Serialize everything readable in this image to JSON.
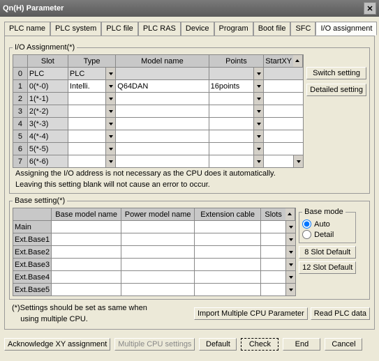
{
  "window": {
    "title": "Qn(H) Parameter",
    "close": "✕"
  },
  "tabs": [
    "PLC name",
    "PLC system",
    "PLC file",
    "PLC RAS",
    "Device",
    "Program",
    "Boot file",
    "SFC",
    "I/O assignment"
  ],
  "activeTab": "I/O assignment",
  "io": {
    "legend": "I/O Assignment(*)",
    "cols": {
      "slot": "Slot",
      "type": "Type",
      "model": "Model name",
      "points": "Points",
      "start": "StartXY"
    },
    "rows": [
      {
        "n": "0",
        "slot": "PLC",
        "type": "PLC",
        "model": "",
        "points": "",
        "gray": true
      },
      {
        "n": "1",
        "slot": "0(*-0)",
        "type": "Intelli.",
        "model": "Q64DAN",
        "points": "16points"
      },
      {
        "n": "2",
        "slot": "1(*-1)",
        "type": "",
        "model": "",
        "points": ""
      },
      {
        "n": "3",
        "slot": "2(*-2)",
        "type": "",
        "model": "",
        "points": ""
      },
      {
        "n": "4",
        "slot": "3(*-3)",
        "type": "",
        "model": "",
        "points": ""
      },
      {
        "n": "5",
        "slot": "4(*-4)",
        "type": "",
        "model": "",
        "points": ""
      },
      {
        "n": "6",
        "slot": "5(*-5)",
        "type": "",
        "model": "",
        "points": ""
      },
      {
        "n": "7",
        "slot": "6(*-6)",
        "type": "",
        "model": "",
        "points": ""
      }
    ],
    "switch": "Switch setting",
    "detailed": "Detailed setting",
    "note1": "Assigning the I/O address is not necessary as the CPU does it automatically.",
    "note2": "Leaving this setting blank will not cause an error to occur."
  },
  "base": {
    "legend": "Base setting(*)",
    "cols": {
      "base": "Base model name",
      "power": "Power model name",
      "ext": "Extension cable",
      "slots": "Slots"
    },
    "rows": [
      "Main",
      "Ext.Base1",
      "Ext.Base2",
      "Ext.Base3",
      "Ext.Base4",
      "Ext.Base5"
    ],
    "mode": {
      "legend": "Base mode",
      "auto": "Auto",
      "detail": "Detail"
    },
    "slot8": "8 Slot Default",
    "slot12": "12 Slot Default"
  },
  "footer": {
    "note1": "(*)Settings should be set as same when",
    "note2": "    using multiple CPU.",
    "import": "Import Multiple CPU Parameter",
    "read": "Read PLC data"
  },
  "buttons": {
    "ack": "Acknowledge XY assignment",
    "multi": "Multiple CPU settings",
    "default": "Default",
    "check": "Check",
    "end": "End",
    "cancel": "Cancel"
  }
}
